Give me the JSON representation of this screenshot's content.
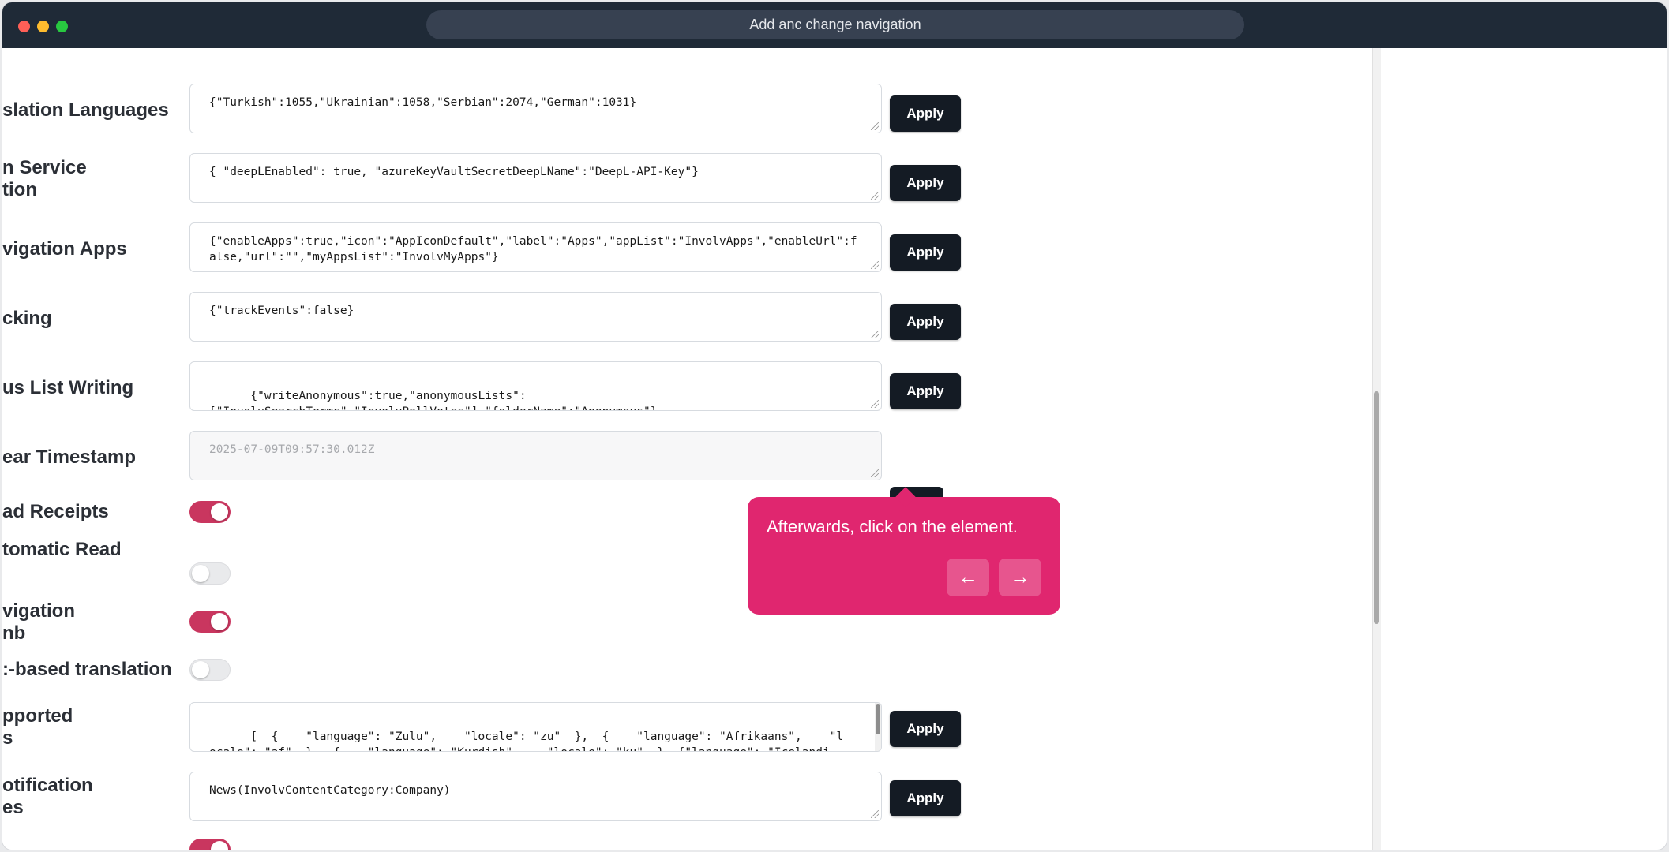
{
  "window": {
    "title": "Add anc change navigation"
  },
  "settings": [
    {
      "label": "slation Languages",
      "value": "{\"Turkish\":1055,\"Ukrainian\":1058,\"Serbian\":2074,\"German\":1031}",
      "action": "Apply"
    },
    {
      "label": "n Service\ntion",
      "value": "{ \"deepLEnabled\": true, \"azureKeyVaultSecretDeepLName\":\"DeepL-API-Key\"}",
      "action": "Apply"
    },
    {
      "label": "vigation Apps",
      "value": "{\"enableApps\":true,\"icon\":\"AppIconDefault\",\"label\":\"Apps\",\"appList\":\"InvolvApps\",\"enableUrl\":false,\"url\":\"\",\"myAppsList\":\"InvolvMyApps\"}",
      "action": "Apply"
    },
    {
      "label": "cking",
      "value": "{\"trackEvents\":false}",
      "action": "Apply"
    },
    {
      "label": "us List Writing",
      "value": "{\"writeAnonymous\":true,\"anonymousLists\":\n[\"InvolvSearchTerms\",\"InvolvPollVotes\"],\"folderName\":\"Anonymous\"}",
      "action": "Apply"
    },
    {
      "label": "ear Timestamp",
      "value": "2025-07-09T09:57:30.012Z"
    }
  ],
  "toggles": [
    {
      "label": "ad Receipts",
      "on": true
    },
    {
      "label": "tomatic Read",
      "on": false
    },
    {
      "label": "vigation\nnb",
      "on": true
    },
    {
      "label": ":-based translation",
      "on": false
    }
  ],
  "settings_lower": [
    {
      "label": "pported\ns",
      "value": "[  {    \"language\": \"Zulu\",    \"locale\": \"zu\"  },  {    \"language\": \"Afrikaans\",    \"locale\": \"af\"  },  {    \"language\": \"Kurdish\",    \"locale\": \"ku\"  }, {\"language\": \"Icelandic\",\n\"locale\": \"is\"  }]",
      "action": "Apply"
    },
    {
      "label": "otification\nes",
      "value": "News(InvolvContentCategory:Company)",
      "action": "Apply"
    }
  ],
  "bottom_toggle": {
    "on": true
  },
  "tooltip": {
    "message": "Afterwards, click on the element.",
    "prev_icon": "arrow-left-icon",
    "next_icon": "arrow-right-icon",
    "prev_glyph": "←",
    "next_glyph": "→",
    "color": "#e0266f"
  },
  "refresh_icon": {
    "name": "refresh-icon",
    "glyph": "↻"
  }
}
